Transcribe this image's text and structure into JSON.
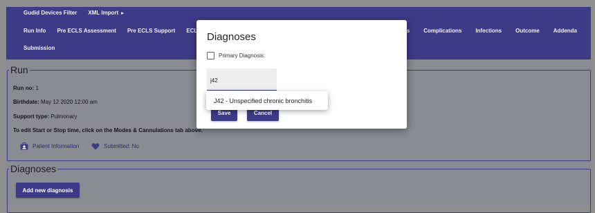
{
  "nav": {
    "row1": [
      {
        "label": "Gudid Devices Filter"
      },
      {
        "label": "XML Import",
        "caret": "▸"
      }
    ],
    "row2": [
      {
        "label": "Run Info"
      },
      {
        "label": "Pre ECLS Assessment"
      },
      {
        "label": "Pre ECLS Support"
      },
      {
        "label": "ECLS A"
      }
    ],
    "row2_right": [
      {
        "label": "ures"
      },
      {
        "label": "Complications"
      },
      {
        "label": "Infections"
      },
      {
        "label": "Outcome"
      },
      {
        "label": "Addenda"
      }
    ],
    "row3": [
      {
        "label": "Submission"
      }
    ]
  },
  "run": {
    "legend": "Run",
    "run_no_label": "Run no:",
    "run_no": "1",
    "birthdate_label": "Birthdate:",
    "birthdate": "May 12 2020 12:00 am",
    "support_type_label": "Support type:",
    "support_type": "Pulmonary",
    "edit_note": "To edit Start or Stop time, click on the Modes & Cannulations tab above.",
    "patient_info_link": "Patient Information",
    "submitted": "Submitted: No"
  },
  "diagnoses_section": {
    "legend": "Diagnoses",
    "add_button": "Add new diagnosis"
  },
  "modal": {
    "title": "Diagnoses",
    "primary_label": "Primary Diagnosis:",
    "search_value": "j42",
    "save": "Save",
    "cancel": "Cancel",
    "option": "J42 - Unspecified chronic bronchitis"
  },
  "colors": {
    "primary": "#3d3a88"
  }
}
